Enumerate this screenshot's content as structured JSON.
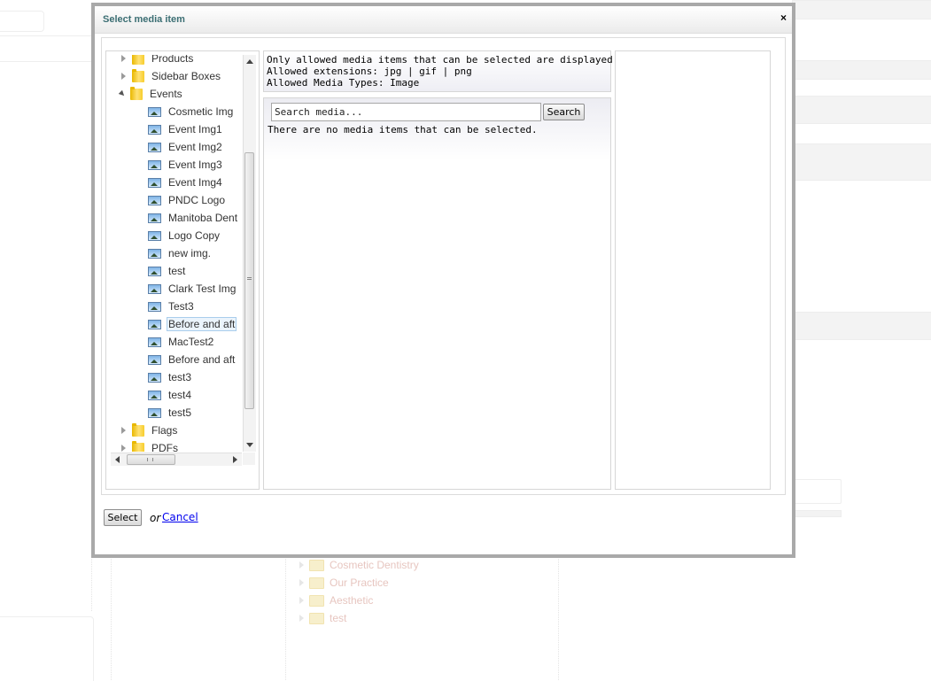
{
  "background": {
    "tree_items": [
      {
        "label": "Cosmetic Dentistry"
      },
      {
        "label": "Our Practice"
      },
      {
        "label": "Aesthetic"
      },
      {
        "label": "test"
      }
    ]
  },
  "dialog": {
    "title": "Select media item",
    "close_label": "×"
  },
  "tree": {
    "items": [
      {
        "label": "Products",
        "type": "folder",
        "toggle": "closed",
        "selected": false
      },
      {
        "label": "Sidebar Boxes",
        "type": "folder",
        "toggle": "closed",
        "selected": false
      },
      {
        "label": "Events",
        "type": "folder",
        "toggle": "open",
        "selected": false
      },
      {
        "label": "Cosmetic Img",
        "type": "image",
        "selected": false
      },
      {
        "label": "Event Img1",
        "type": "image",
        "selected": false
      },
      {
        "label": "Event Img2",
        "type": "image",
        "selected": false
      },
      {
        "label": "Event Img3",
        "type": "image",
        "selected": false
      },
      {
        "label": "Event Img4",
        "type": "image",
        "selected": false
      },
      {
        "label": "PNDC Logo",
        "type": "image",
        "selected": false
      },
      {
        "label": "Manitoba Dent",
        "type": "image",
        "selected": false
      },
      {
        "label": "Logo Copy",
        "type": "image",
        "selected": false
      },
      {
        "label": "new img.",
        "type": "image",
        "selected": false
      },
      {
        "label": "test",
        "type": "image",
        "selected": false
      },
      {
        "label": "Clark Test Img",
        "type": "image",
        "selected": false
      },
      {
        "label": "Test3",
        "type": "image",
        "selected": false
      },
      {
        "label": "Before and aft",
        "type": "image",
        "selected": true
      },
      {
        "label": "MacTest2",
        "type": "image",
        "selected": false
      },
      {
        "label": "Before and aft",
        "type": "image",
        "selected": false
      },
      {
        "label": "test3",
        "type": "image",
        "selected": false
      },
      {
        "label": "test4",
        "type": "image",
        "selected": false
      },
      {
        "label": "test5",
        "type": "image",
        "selected": false
      },
      {
        "label": "Flags",
        "type": "folder",
        "toggle": "closed",
        "selected": false
      },
      {
        "label": "PDFs",
        "type": "folder",
        "toggle": "closed",
        "selected": false
      }
    ],
    "hscroll_grip": "III"
  },
  "info": {
    "line1": "Only allowed media items that can be selected are displayed.",
    "line2": "Allowed extensions: jpg | gif | png",
    "line3": "Allowed Media Types: Image"
  },
  "search": {
    "placeholder": "Search media...",
    "value": "Search media...",
    "button_label": "Search",
    "empty_message": "There are no media items that can be selected."
  },
  "footer": {
    "select_label": "Select",
    "or_text": "or",
    "cancel_label": "Cancel"
  },
  "colors": {
    "title": "#3b6e73",
    "link": "#0000ee",
    "selection_bg": "#ebf4fc",
    "selection_border": "#a9cdec",
    "modal_border": "#a9a9a9"
  }
}
